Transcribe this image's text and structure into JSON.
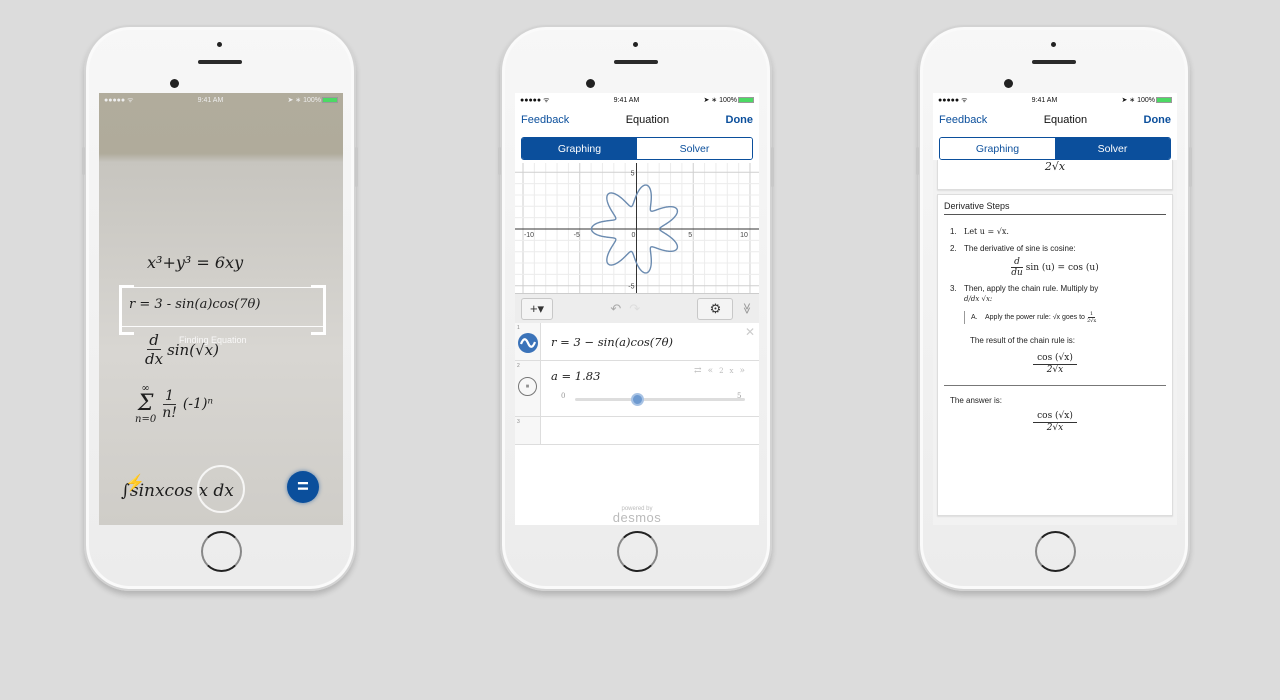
{
  "status_bar": {
    "signal": "●●●●● ᯤ",
    "time": "9:41 AM",
    "right": "➤ ∗ 100%"
  },
  "camera_screen": {
    "handwritten": {
      "line1": "x³+y³ = 6xy",
      "line2": "r = 3 - sin(a)cos(7θ)",
      "line3_top": "d",
      "line3_bottom": "dx",
      "line3_rest": "sin(√x)",
      "line4_sum_top": "∞",
      "line4_sigma": "Σ",
      "line4_sum_bottom": "n=0",
      "line4_num": "1",
      "line4_den": "n!",
      "line4_rest": "(-1)ⁿ",
      "line5": "∫sinxcos x dx"
    },
    "scan_label": "Finding Equation",
    "equals_button": "=",
    "flash_icon": "⚡"
  },
  "graphing_screen": {
    "nav": {
      "left": "Feedback",
      "title": "Equation",
      "right": "Done"
    },
    "tabs": [
      {
        "label": "Graphing",
        "active": true
      },
      {
        "label": "Solver",
        "active": false
      }
    ],
    "graph": {
      "x_ticks": [
        "-10",
        "-5",
        "0",
        "5",
        "10"
      ],
      "y_ticks": [
        "5",
        "-5"
      ],
      "curve": "r = 3 - sin(1.83)cos(7θ)",
      "a": 1.83,
      "color": "#6b8bb0"
    },
    "toolbar": {
      "add": "+▾",
      "undo": "↶",
      "redo": "↷",
      "settings": "⚙",
      "collapse": "≫"
    },
    "expressions": [
      {
        "num": "1",
        "text": "r = 3 − sin(a)cos(7θ)",
        "close": "✕"
      },
      {
        "num": "2",
        "text": "a = 1.83",
        "slider_min": "0",
        "slider_max": "5",
        "slider_fraction": 0.366,
        "controls": [
          "⇄",
          "«",
          "2x",
          "»"
        ],
        "pause": "⏸"
      },
      {
        "num": "3",
        "text": ""
      }
    ],
    "powered_by": "powered by",
    "brand": "desmos"
  },
  "solver_screen": {
    "nav": {
      "left": "Feedback",
      "title": "Equation",
      "right": "Done"
    },
    "tabs": [
      {
        "label": "Graphing",
        "active": false
      },
      {
        "label": "Solver",
        "active": true
      }
    ],
    "top_expr": "2√x",
    "section_title": "Derivative Steps",
    "steps": [
      {
        "idx": "1.",
        "text": "Let u = √x."
      },
      {
        "idx": "2.",
        "text": "The derivative of sine is cosine:",
        "formula_num": "d",
        "formula_den": "du",
        "formula_rest": "sin (u) = cos (u)"
      },
      {
        "idx": "3.",
        "text": "Then, apply the chain rule. Multiply by",
        "formula": "d/dx √x:"
      }
    ],
    "substep": {
      "idx": "A.",
      "text": "Apply the power rule: √x goes to",
      "frac_num": "1",
      "frac_den": "2√x"
    },
    "chain_result_label": "The result of the chain rule is:",
    "chain_result_num": "cos (√x)",
    "chain_result_den": "2√x",
    "answer_label": "The answer is:",
    "answer_num": "cos (√x)",
    "answer_den": "2√x"
  }
}
